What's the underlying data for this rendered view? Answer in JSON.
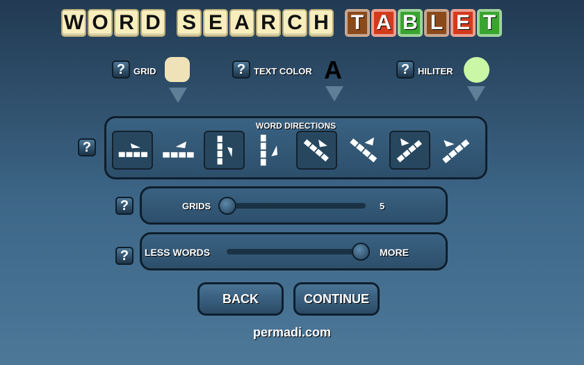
{
  "title": {
    "word1": [
      "W",
      "O",
      "R",
      "D"
    ],
    "word2": [
      "S",
      "E",
      "A",
      "R",
      "C",
      "H"
    ],
    "word3": [
      {
        "letter": "T",
        "color": "#8b4a1c"
      },
      {
        "letter": "A",
        "color": "#d23b1e"
      },
      {
        "letter": "B",
        "color": "#3aa431"
      },
      {
        "letter": "L",
        "color": "#8b4a1c"
      },
      {
        "letter": "E",
        "color": "#d23b1e"
      },
      {
        "letter": "T",
        "color": "#3aa431"
      }
    ]
  },
  "settings": {
    "grid_label": "GRID",
    "text_color_label": "TEXT COLOR",
    "text_color_sample": "A",
    "hiliter_label": "HILITER",
    "grid_color": "#efe2b8",
    "text_color": "#000000",
    "hiliter_color": "#c9f7a6"
  },
  "directions": {
    "title": "WORD DIRECTIONS",
    "items": [
      {
        "name": "horizontal-forward",
        "selected": true
      },
      {
        "name": "horizontal-backward",
        "selected": false
      },
      {
        "name": "vertical-down",
        "selected": true
      },
      {
        "name": "vertical-up",
        "selected": false
      },
      {
        "name": "diagonal-down-right",
        "selected": true
      },
      {
        "name": "diagonal-up-left",
        "selected": false
      },
      {
        "name": "diagonal-up-right",
        "selected": true
      },
      {
        "name": "diagonal-down-left",
        "selected": false
      }
    ]
  },
  "grids": {
    "label": "GRIDS",
    "value": "5",
    "level": 0.0
  },
  "words": {
    "less_label": "LESS WORDS",
    "more_label": "MORE",
    "level": 1.0
  },
  "buttons": {
    "back": "BACK",
    "continue": "CONTINUE"
  },
  "help": "?",
  "footer": "permadi.com"
}
